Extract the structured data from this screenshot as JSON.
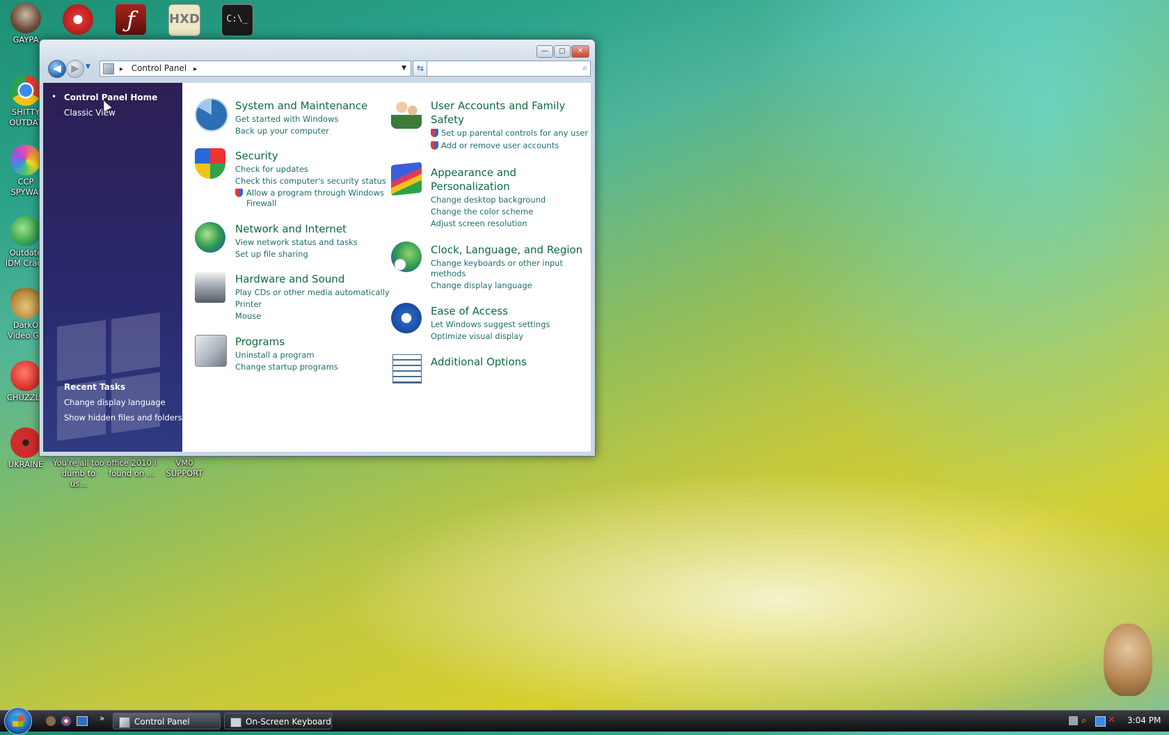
{
  "desktop": {
    "left_icons": [
      {
        "label": "GAYPA",
        "icon": "raccoon-icon",
        "color": "#6b4a3a"
      },
      {
        "label": "SHITTY OUTDAT",
        "icon": "chrome-icon",
        "color": "#2f86e6"
      },
      {
        "label": "CCP SPYWA.",
        "icon": "colorful-circle-icon",
        "color": "#e74fa1"
      },
      {
        "label": "Outdate IDM Crack",
        "icon": "globe-download-icon",
        "color": "#3ba54f"
      },
      {
        "label": "DarkO Video Ga",
        "icon": "money-bag-icon",
        "color": "#b88a3c"
      },
      {
        "label": "CHUZZLE",
        "icon": "chuzzle-icon",
        "color": "#d8362e"
      },
      {
        "label": "UKRAINE",
        "icon": "radiation-icon",
        "color": "#cf2c2c"
      }
    ],
    "bottom_icons": [
      {
        "label": "You're all too dumb to us...",
        "icon": "document-icon"
      },
      {
        "label": "office 2010 i found on ...",
        "icon": "office-icon"
      },
      {
        "label": "VM0 SUPPORT",
        "icon": "vm-icon"
      }
    ],
    "top_icons": [
      {
        "icon": "p-app-icon",
        "color": "#d33"
      },
      {
        "icon": "flash-icon",
        "color": "#8a1b14"
      },
      {
        "icon": "hxd-icon",
        "color": "#dfd8b0"
      },
      {
        "icon": "console-icon",
        "color": "#222"
      }
    ]
  },
  "window": {
    "title_buttons": {
      "minimize": "—",
      "maximize": "▢",
      "close": "✕"
    },
    "breadcrumb": {
      "root_arrow": "▸",
      "item": "Control Panel",
      "trail_arrow": "▸"
    },
    "search_placeholder": "",
    "left_pane": {
      "bullet": "•",
      "home": "Control Panel Home",
      "classic": "Classic View",
      "recent_heading": "Recent Tasks",
      "recent_tasks": [
        "Change display language",
        "Show hidden files and folders"
      ]
    },
    "categories_left": [
      {
        "title": "System and Maintenance",
        "icon": "system-maintenance-icon",
        "links": [
          "Get started with Windows",
          "Back up your computer"
        ]
      },
      {
        "title": "Security",
        "icon": "security-shield-icon",
        "links": [
          "Check for updates",
          "Check this computer's security status",
          "Allow a program through Windows",
          "Firewall"
        ]
      },
      {
        "title": "Network and Internet",
        "icon": "network-globe-icon",
        "links": [
          "View network status and tasks",
          "Set up file sharing"
        ]
      },
      {
        "title": "Hardware and Sound",
        "icon": "printer-speaker-icon",
        "links": [
          "Play CDs or other media automatically",
          "Printer",
          "Mouse"
        ]
      },
      {
        "title": "Programs",
        "icon": "programs-icon",
        "links": [
          "Uninstall a program",
          "Change startup programs"
        ]
      }
    ],
    "categories_right": [
      {
        "title": "User Accounts and Family",
        "title2": "Safety",
        "icon": "user-accounts-icon",
        "links": [
          "Set up parental controls for any user",
          "Add or remove user accounts"
        ]
      },
      {
        "title": "Appearance and",
        "title2": "Personalization",
        "icon": "appearance-icon",
        "links": [
          "Change desktop background",
          "Change the color scheme",
          "Adjust screen resolution"
        ]
      },
      {
        "title": "Clock, Language, and Region",
        "icon": "clock-globe-icon",
        "links": [
          "Change keyboards or other input",
          "methods",
          "Change display language"
        ]
      },
      {
        "title": "Ease of Access",
        "icon": "ease-of-access-icon",
        "links": [
          "Let Windows suggest settings",
          "Optimize visual display"
        ]
      },
      {
        "title": "Additional Options",
        "icon": "additional-options-icon",
        "links": []
      }
    ]
  },
  "taskbar": {
    "quick_launch_more": "»",
    "buttons": [
      "Control Panel",
      "On-Screen Keyboard"
    ],
    "clock": "3:04 PM"
  },
  "colors": {
    "category_title": "#0f6b3e",
    "category_link": "#1f6e6e",
    "left_pane": "#2a2a6e"
  }
}
